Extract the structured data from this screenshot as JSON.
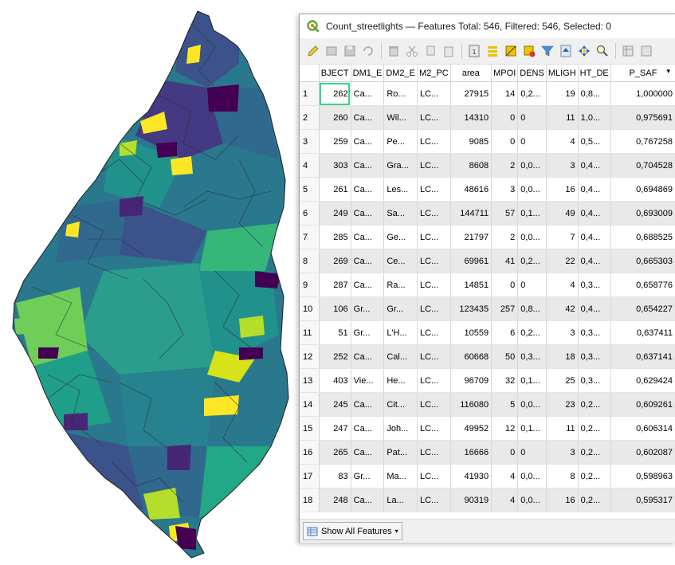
{
  "window": {
    "title": "Count_streetlights — Features Total: 546, Filtered: 546, Selected: 0"
  },
  "toolbar": {
    "icons": [
      "pencil-icon",
      "multi-edit-icon",
      "save-icon",
      "reload-icon",
      "delete-feature-icon",
      "cut-icon",
      "copy-icon",
      "paste-icon",
      "calculator-icon",
      "select-all-icon",
      "invert-selection-icon",
      "deselect-icon",
      "filter-icon",
      "move-top-icon",
      "pan-icon",
      "zoom-icon",
      "organize-icon",
      "dock-icon"
    ]
  },
  "table": {
    "headers": [
      "BJECT",
      "DM1_E",
      "DM2_E",
      "M2_PC",
      "area",
      "MPOI",
      "DENS",
      "MLIGH",
      "HT_DE",
      "P_SAF"
    ],
    "rows": [
      {
        "n": "1",
        "c": [
          "262",
          "Ca...",
          "Ro...",
          "LC...",
          "27915",
          "14",
          "0,2...",
          "19",
          "0,8...",
          "1,000000"
        ]
      },
      {
        "n": "2",
        "c": [
          "260",
          "Ca...",
          "Wil...",
          "LC...",
          "14310",
          "0",
          "0",
          "11",
          "1,0...",
          "0,975691"
        ]
      },
      {
        "n": "3",
        "c": [
          "259",
          "Ca...",
          "Pe...",
          "LC...",
          "9085",
          "0",
          "0",
          "4",
          "0,5...",
          "0,767258"
        ]
      },
      {
        "n": "4",
        "c": [
          "303",
          "Ca...",
          "Gra...",
          "LC...",
          "8608",
          "2",
          "0,0...",
          "3",
          "0,4...",
          "0,704528"
        ]
      },
      {
        "n": "5",
        "c": [
          "261",
          "Ca...",
          "Les...",
          "LC...",
          "48616",
          "3",
          "0,0...",
          "16",
          "0,4...",
          "0,694869"
        ]
      },
      {
        "n": "6",
        "c": [
          "249",
          "Ca...",
          "Sa...",
          "LC...",
          "144711",
          "57",
          "0,1...",
          "49",
          "0,4...",
          "0,693009"
        ]
      },
      {
        "n": "7",
        "c": [
          "285",
          "Ca...",
          "Ge...",
          "LC...",
          "21797",
          "2",
          "0,0...",
          "7",
          "0,4...",
          "0,688525"
        ]
      },
      {
        "n": "8",
        "c": [
          "269",
          "Ca...",
          "Ce...",
          "LC...",
          "69961",
          "41",
          "0,2...",
          "22",
          "0,4...",
          "0,665303"
        ]
      },
      {
        "n": "9",
        "c": [
          "287",
          "Ca...",
          "Ra...",
          "LC...",
          "14851",
          "0",
          "0",
          "4",
          "0,3...",
          "0,658776"
        ]
      },
      {
        "n": "10",
        "c": [
          "106",
          "Gr...",
          "Gr...",
          "LC...",
          "123435",
          "257",
          "0,8...",
          "42",
          "0,4...",
          "0,654227"
        ]
      },
      {
        "n": "11",
        "c": [
          "51",
          "Gr...",
          "L'H...",
          "LC...",
          "10559",
          "6",
          "0,2...",
          "3",
          "0,3...",
          "0,637411"
        ]
      },
      {
        "n": "12",
        "c": [
          "252",
          "Ca...",
          "Cal...",
          "LC...",
          "60668",
          "50",
          "0,3...",
          "18",
          "0,3...",
          "0,637141"
        ]
      },
      {
        "n": "13",
        "c": [
          "403",
          "Vie...",
          "He...",
          "LC...",
          "96709",
          "32",
          "0,1...",
          "25",
          "0,3...",
          "0,629424"
        ]
      },
      {
        "n": "14",
        "c": [
          "245",
          "Ca...",
          "Cit...",
          "LC...",
          "116080",
          "5",
          "0,0...",
          "23",
          "0,2...",
          "0,609261"
        ]
      },
      {
        "n": "15",
        "c": [
          "247",
          "Ca...",
          "Joh...",
          "LC...",
          "49952",
          "12",
          "0,1...",
          "11",
          "0,2...",
          "0,606314"
        ]
      },
      {
        "n": "16",
        "c": [
          "265",
          "Ca...",
          "Pat...",
          "LC...",
          "16666",
          "0",
          "0",
          "3",
          "0,2...",
          "0,602087"
        ]
      },
      {
        "n": "17",
        "c": [
          "83",
          "Gr...",
          "Ma...",
          "LC...",
          "41930",
          "4",
          "0,0...",
          "8",
          "0,2...",
          "0,598963"
        ]
      },
      {
        "n": "18",
        "c": [
          "248",
          "Ca...",
          "La...",
          "LC...",
          "90319",
          "4",
          "0,0...",
          "16",
          "0,2...",
          "0,595317"
        ]
      }
    ]
  },
  "bottom": {
    "show_all_label": "Show All Features"
  },
  "map": {
    "palette": [
      "#440154",
      "#3b528b",
      "#21918c",
      "#5ec962",
      "#fde725"
    ]
  }
}
